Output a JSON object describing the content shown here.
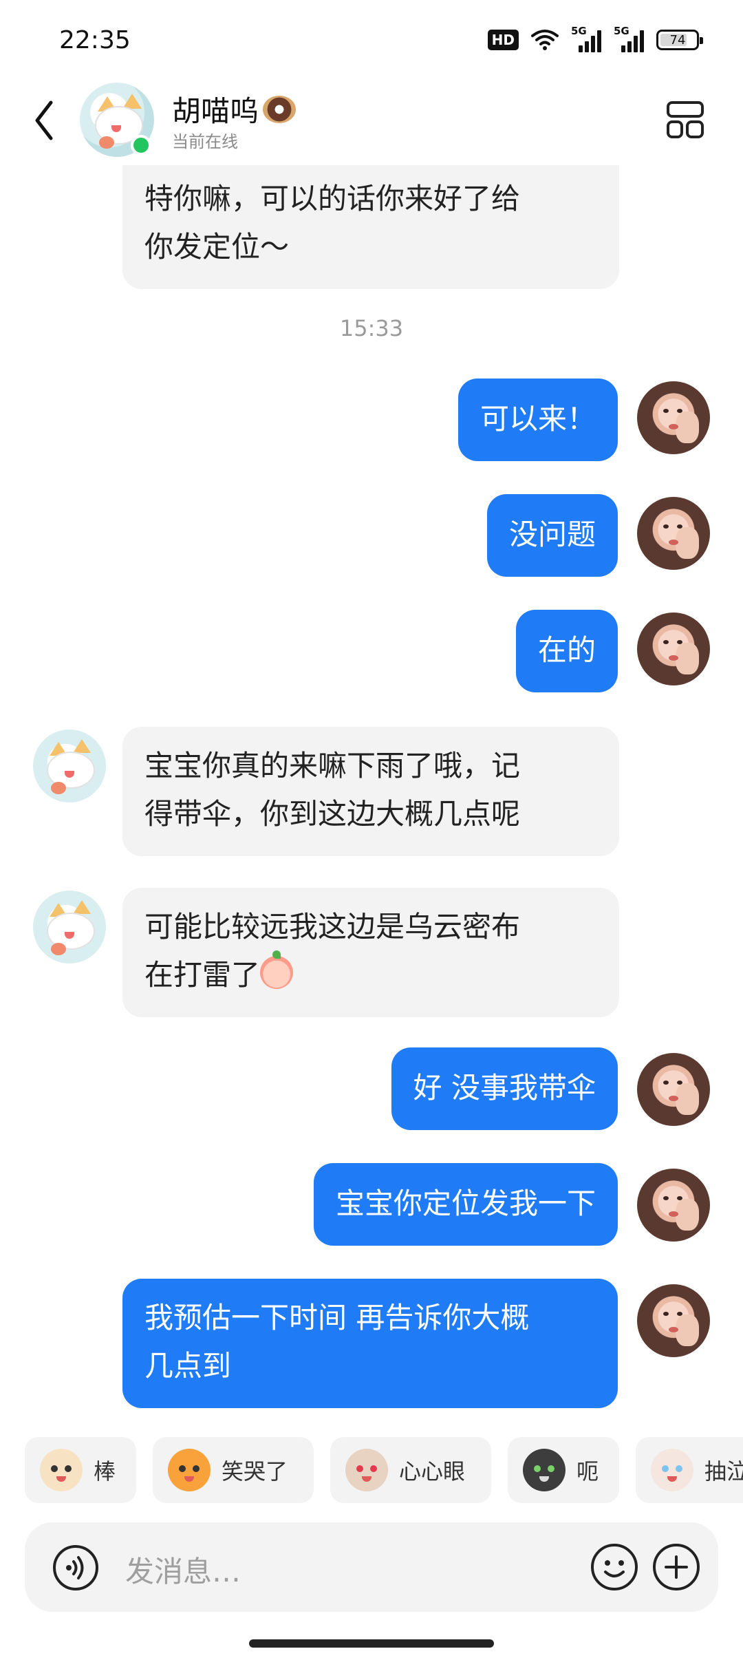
{
  "status_bar": {
    "time": "22:35",
    "network_badge": "HD",
    "sim1_tag": "5G",
    "sim2_tag": "5G",
    "battery_level": "74"
  },
  "header": {
    "back_icon": "chevron-left-icon",
    "contact_name": "胡喵呜",
    "name_emoji": "donut-emoji",
    "online_status": "当前在线",
    "menu_icon": "layout-grid-icon"
  },
  "messages": [
    {
      "side": "in",
      "text": "特你嘛，可以的话你来好了给\n你发定位～"
    },
    {
      "type": "timestamp",
      "text": "15:33"
    },
    {
      "side": "out",
      "text": "可以来！"
    },
    {
      "side": "out",
      "text": "没问题"
    },
    {
      "side": "out",
      "text": "在的"
    },
    {
      "side": "in",
      "text": "宝宝你真的来嘛下雨了哦，记\n得带伞，你到这边大概几点呢"
    },
    {
      "side": "in",
      "text": "可能比较远我这边是乌云密布\n在打雷了",
      "emoji": "crying-peach-emoji"
    },
    {
      "side": "out",
      "text": "好 没事我带伞"
    },
    {
      "side": "out",
      "text": "宝宝你定位发我一下"
    },
    {
      "side": "out",
      "text": "我预估一下时间 再告诉你大概\n几点到"
    }
  ],
  "sticker_suggestions": [
    {
      "label": "棒",
      "icon": "thumbs-up-cat-sticker"
    },
    {
      "label": "笑哭了",
      "icon": "laughing-crying-cat-sticker"
    },
    {
      "label": "心心眼",
      "icon": "heart-eyes-cat-sticker"
    },
    {
      "label": "呃",
      "icon": "awkward-cat-sticker"
    },
    {
      "label": "抽泣",
      "icon": "sobbing-cat-sticker"
    }
  ],
  "input": {
    "placeholder": "发消息…",
    "voice_icon": "voice-input-icon",
    "emoji_icon": "emoji-icon",
    "plus_icon": "plus-icon"
  }
}
